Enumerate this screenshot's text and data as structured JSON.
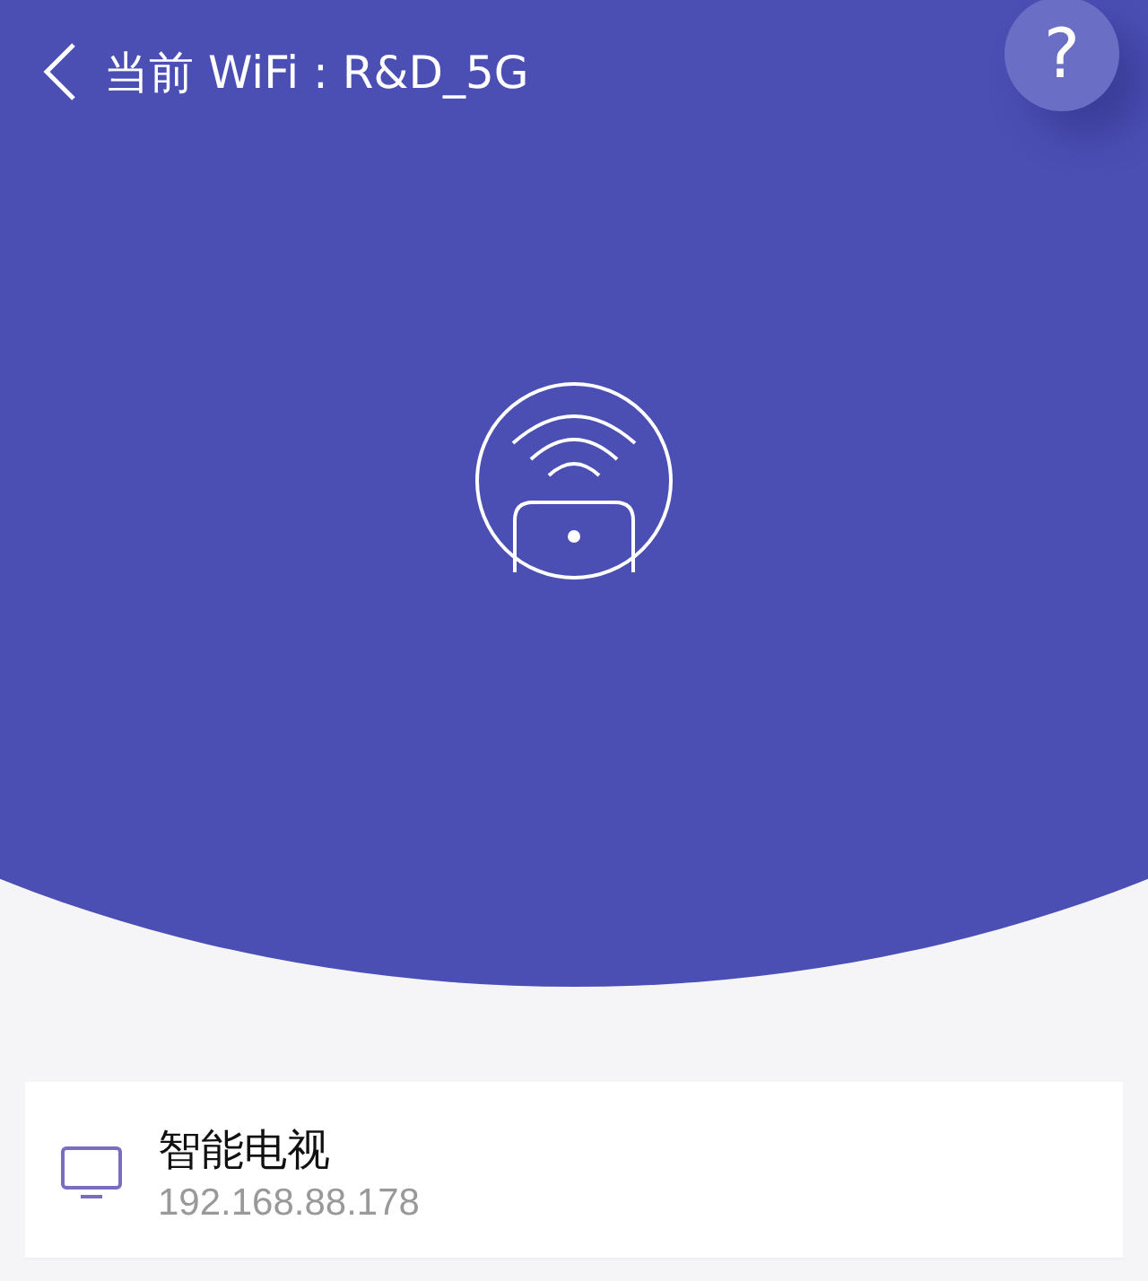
{
  "header": {
    "title": "当前 WiFi : R&D_5G",
    "help_button": "?"
  },
  "devices": [
    {
      "name": "智能电视",
      "ip": "192.168.88.178",
      "kind": "tv"
    }
  ]
}
